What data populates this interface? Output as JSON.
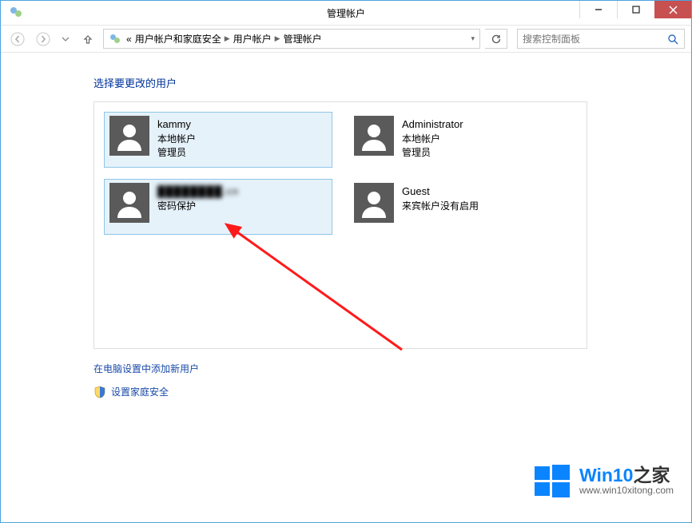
{
  "titlebar": {
    "title": "管理帐户"
  },
  "breadcrumb": {
    "lead": "«",
    "items": [
      "用户帐户和家庭安全",
      "用户帐户",
      "管理帐户"
    ]
  },
  "search": {
    "placeholder": "搜索控制面板"
  },
  "page": {
    "heading": "选择要更改的用户"
  },
  "accounts": [
    {
      "name": "kammy",
      "line2": "本地帐户",
      "line3": "管理员"
    },
    {
      "name": "Administrator",
      "line2": "本地帐户",
      "line3": "管理员"
    },
    {
      "name_masked": "████████.cn",
      "line2": "密码保护",
      "line3": ""
    },
    {
      "name": "Guest",
      "line2": "来宾帐户没有启用",
      "line3": ""
    }
  ],
  "links": {
    "add_user": "在电脑设置中添加新用户",
    "family_safety": "设置家庭安全"
  },
  "watermark": {
    "brand_prefix": "Win10",
    "brand_suffix": "之家",
    "url": "www.win10xitong.com"
  }
}
